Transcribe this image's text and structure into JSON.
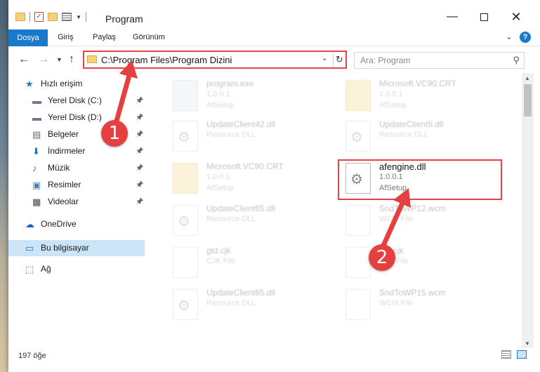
{
  "titlebar": {
    "title": "Program",
    "minimize": "—",
    "close": "✕"
  },
  "ribbon": {
    "tabs": [
      "Dosya",
      "Giriş",
      "Paylaş",
      "Görünüm"
    ],
    "expand_icon": "chevron-down-icon",
    "help": "?"
  },
  "address": {
    "path": "C:\\Program Files\\Program Dizini",
    "dropdown": "⌄",
    "refresh": "↻"
  },
  "search": {
    "placeholder": "Ara: Program",
    "icon": "⚲"
  },
  "sidebar": {
    "items": [
      {
        "label": "Hızlı erişim",
        "icon": "star-icon",
        "pinned": false
      },
      {
        "label": "Yerel Disk (C:)",
        "icon": "drive-icon",
        "pinned": true
      },
      {
        "label": "Yerel Disk (D:)",
        "icon": "drive-icon",
        "pinned": true
      },
      {
        "label": "Belgeler",
        "icon": "documents-icon",
        "pinned": true
      },
      {
        "label": "İndirmeler",
        "icon": "download-icon",
        "pinned": true
      },
      {
        "label": "Müzik",
        "icon": "music-icon",
        "pinned": true
      },
      {
        "label": "Resimler",
        "icon": "pictures-icon",
        "pinned": true
      },
      {
        "label": "Videolar",
        "icon": "video-icon",
        "pinned": true
      },
      {
        "label": "OneDrive",
        "icon": "cloud-icon",
        "pinned": false
      },
      {
        "label": "Bu bilgisayar",
        "icon": "computer-icon",
        "pinned": false,
        "selected": true
      },
      {
        "label": "Ağ",
        "icon": "network-icon",
        "pinned": false
      }
    ]
  },
  "files": [
    {
      "name": "program.exe",
      "line1": "1.0.0.1",
      "line2": "AfSetup",
      "icon": "exe-icon",
      "faded": true
    },
    {
      "name": "Microsoft.VC90.CRT",
      "line1": "1.0.0.1",
      "line2": "AfSetup",
      "icon": "folder-icon",
      "faded": true
    },
    {
      "name": "UpdateClient42.dll",
      "line1": "Resource DLL",
      "line2": "",
      "icon": "dll-icon",
      "faded": true
    },
    {
      "name": "UpdateClient5.dll",
      "line1": "Resource DLL",
      "line2": "",
      "icon": "dll-icon",
      "faded": true
    },
    {
      "name": "Microsoft.VC90.CRT",
      "line1": "1.0.0.1",
      "line2": "AfSetup",
      "icon": "folder-icon",
      "faded": true
    },
    {
      "name": "afengine.dll",
      "line1": "1.0.0.1",
      "line2": "AfSetup",
      "icon": "dll-icon",
      "faded": false,
      "highlighted": true
    },
    {
      "name": "UpdateClient65.dll",
      "line1": "Resource DLL",
      "line2": "",
      "icon": "dll-icon",
      "faded": true
    },
    {
      "name": "SndToWP12.wcm",
      "line1": "WCM File",
      "line2": "",
      "icon": "file-icon",
      "faded": true
    },
    {
      "name": "gtd.cjk",
      "line1": "CJK File",
      "line2": "",
      "icon": "file-icon",
      "faded": true
    },
    {
      "name": "tan.cjk",
      "line1": "CJK File",
      "line2": "",
      "icon": "file-icon",
      "faded": true
    },
    {
      "name": "UpdateClient65.dll",
      "line1": "Resource DLL",
      "line2": "",
      "icon": "dll-icon",
      "faded": true
    },
    {
      "name": "SndToWP15.wcm",
      "line1": "WCM File",
      "line2": "",
      "icon": "file-icon",
      "faded": true
    }
  ],
  "status": {
    "item_count": "197 öğe"
  },
  "annotations": {
    "step1": "1",
    "step2": "2",
    "color": "#e8414a"
  }
}
